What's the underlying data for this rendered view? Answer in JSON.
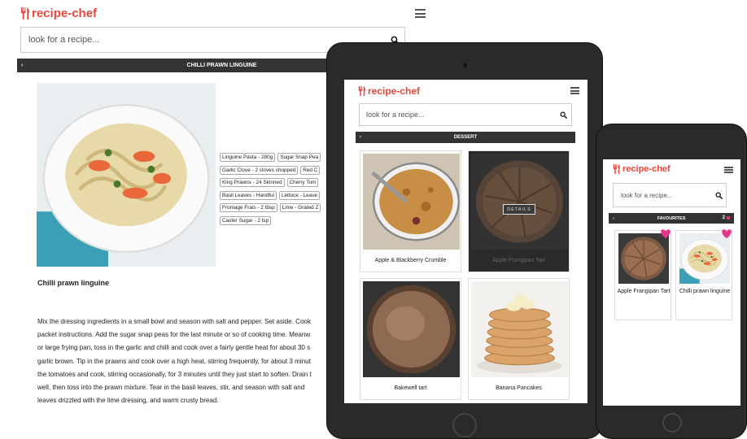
{
  "app": {
    "name": "recipe-chef"
  },
  "colors": {
    "brand": "#e8473e",
    "bar": "#333333",
    "heart": "#e8358a",
    "device": "#2a2a2a"
  },
  "desktop": {
    "search_placeholder": "look for a recipe...",
    "bar_title": "CHILLI PRAWN LINGUINE",
    "recipe_name": "Chilli prawn linguine",
    "ingredients": [
      "Linguine Pasta - 280g",
      "Sugar Snap Pea",
      "Garlic Clove - 2 cloves chopped",
      "Red C",
      "King Prawns - 24 Skinned",
      "Cherry Tom",
      "Basil Leaves - Handful",
      "Lettuce - Leave",
      "Fromage Frais - 2 tbsp",
      "Lime - Grated Z",
      "Caster Sugar - 2 tsp"
    ],
    "method": [
      "Mix the dressing ingredients in a small bowl and season with salt and pepper. Set aside. Cook",
      "packet instructions. Add the sugar snap peas for the last minute or so of cooking time. Meanw",
      "or large frying pan, toss in the garlic and chilli and cook over a fairly gentle heat for about 30 s",
      "garlic brown. Tip in the prawns and cook over a high heat, stirring frequently, for about 3 minut",
      "the tomatoes and cook, stirring occasionally, for 3 minutes until they just start to soften. Drain t",
      "well, then toss into the prawn mixture. Tear in the basil leaves, stir, and season with salt and",
      "leaves drizzled with the lime dressing, and warm crusty bread."
    ]
  },
  "tablet": {
    "search_placeholder": "look for a recipe...",
    "bar_title": "DESSERT",
    "details_label": "DETAILS",
    "cards": [
      {
        "label": "Apple & Blackberry Crumble"
      },
      {
        "label": "Apple Frangipan Tart"
      },
      {
        "label": "Bakewell tart"
      },
      {
        "label": "Banana Pancakes"
      }
    ]
  },
  "phone": {
    "search_placeholder": "look for a recipe...",
    "bar_title": "FAVOURITES",
    "fav_count": "2",
    "cards": [
      {
        "label": "Apple Frangipan Tart"
      },
      {
        "label": "Chilli prawn linguine"
      }
    ]
  }
}
